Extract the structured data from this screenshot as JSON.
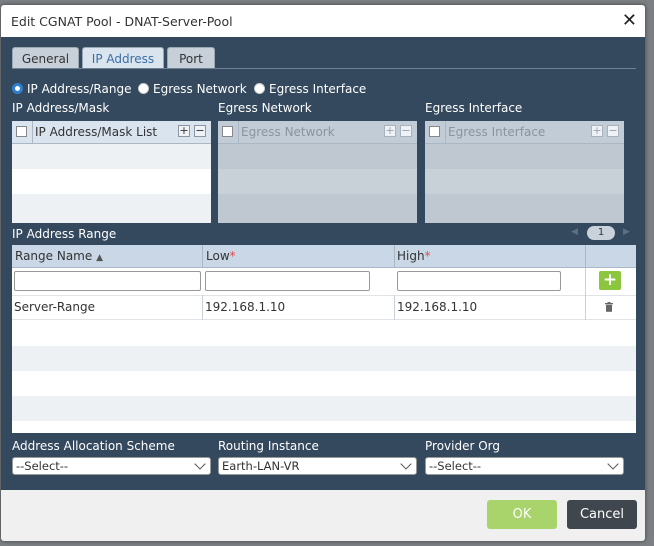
{
  "dialog": {
    "title": "Edit CGNAT Pool - DNAT-Server-Pool",
    "close_icon": "close-icon"
  },
  "tabs": [
    {
      "label": "General",
      "active": false
    },
    {
      "label": "IP Address",
      "active": true
    },
    {
      "label": "Port",
      "active": false
    }
  ],
  "radios": [
    {
      "label": "IP Address/Range",
      "selected": true
    },
    {
      "label": "Egress Network",
      "selected": false
    },
    {
      "label": "Egress Interface",
      "selected": false
    }
  ],
  "panels": {
    "ip_mask": {
      "section": "IP Address/Mask",
      "column": "IP Address/Mask List",
      "enabled": true
    },
    "egress_network": {
      "section": "Egress Network",
      "column": "Egress Network",
      "enabled": false
    },
    "egress_interface": {
      "section": "Egress Interface",
      "column": "Egress Interface",
      "enabled": false
    },
    "add_symbol": "+",
    "remove_symbol": "−"
  },
  "range": {
    "section": "IP Address Range",
    "page": "1",
    "columns": {
      "name": "Range Name",
      "low": "Low",
      "high": "High",
      "required_mark": "*"
    },
    "add_symbol": "+",
    "rows": [
      {
        "name": "Server-Range",
        "low": "192.168.1.10",
        "high": "192.168.1.10"
      }
    ]
  },
  "bottom": {
    "allocation": {
      "label": "Address Allocation Scheme",
      "value": "--Select--"
    },
    "routing": {
      "label": "Routing Instance",
      "value": "Earth-LAN-VR"
    },
    "provider": {
      "label": "Provider Org",
      "value": "--Select--"
    }
  },
  "footer": {
    "ok": "OK",
    "cancel": "Cancel"
  },
  "colors": {
    "dialog_bg": "#34495e",
    "ok_bg": "#a9d46b",
    "cancel_bg": "#3f464d",
    "add_green": "#8cc63f",
    "radio_blue": "#2f7fd1"
  }
}
